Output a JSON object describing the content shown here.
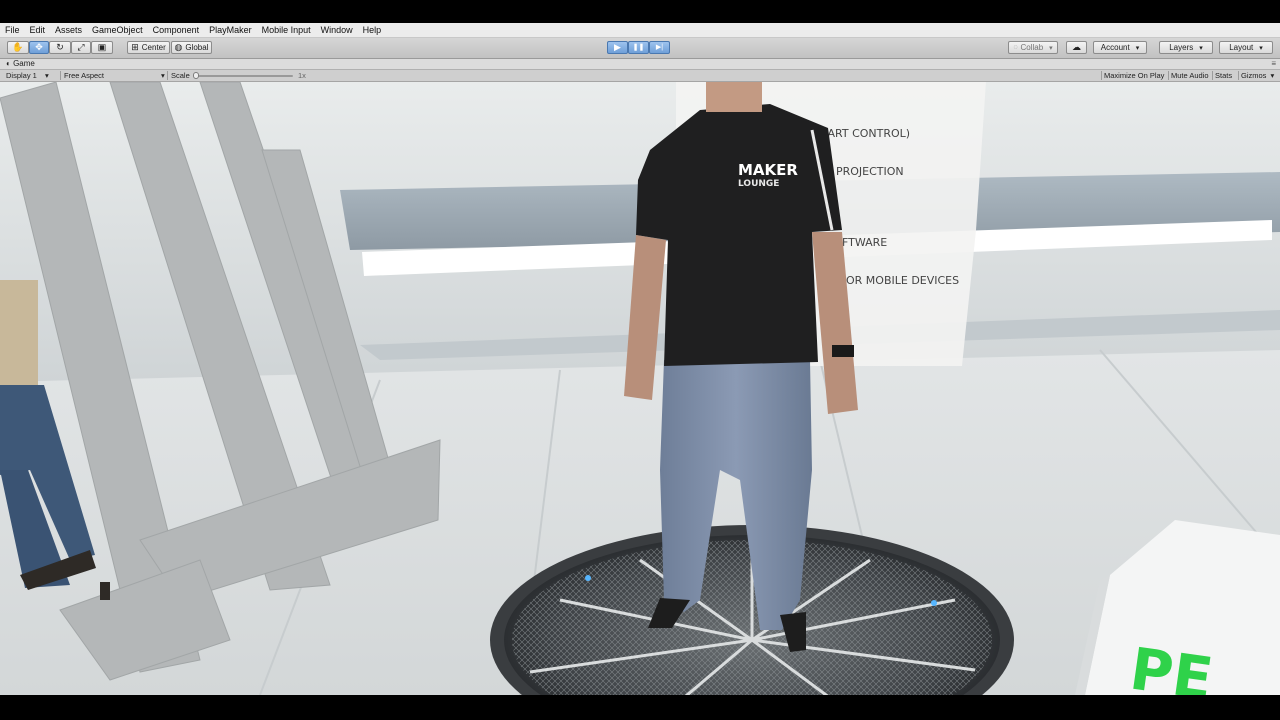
{
  "menubar": {
    "items": [
      "File",
      "Edit",
      "Assets",
      "GameObject",
      "Component",
      "PlayMaker",
      "Mobile Input",
      "Window",
      "Help"
    ]
  },
  "toolbar": {
    "tools": [
      {
        "name": "hand-tool",
        "glyph": "✋"
      },
      {
        "name": "move-tool",
        "glyph": "✥"
      },
      {
        "name": "rotate-tool",
        "glyph": "↻"
      },
      {
        "name": "scale-tool",
        "glyph": "⤢"
      },
      {
        "name": "rect-tool",
        "glyph": "▣"
      }
    ],
    "pivot_mode": "Center",
    "pivot_rotation": "Global",
    "play_glyph": "▶",
    "pause_glyph": "❚❚",
    "step_glyph": "▶|",
    "collab_label": "Collab",
    "cloud_glyph": "☁",
    "account_label": "Account",
    "layers_label": "Layers",
    "layout_label": "Layout"
  },
  "game_tab": {
    "title": "Game",
    "menu_glyph": "≡"
  },
  "game_bar": {
    "display": "Display 1",
    "aspect": "Free Aspect",
    "scale_label": "Scale",
    "scale_value": "1x",
    "maximize_on_play": "Maximize On Play",
    "mute_audio": "Mute Audio",
    "stats": "Stats",
    "gizmos": "Gizmos"
  },
  "scene": {
    "panel_lines": [
      "MART CONTROL)",
      "PROJECTION",
      "FTWARE",
      "OR MOBILE DEVICES"
    ],
    "shirt_logo_line1": "MAKER",
    "shirt_logo_line2": "LOUNGE",
    "cube_text": "PE",
    "colors": {
      "accent_green": "#2fd24a",
      "play_blue": "#6f9fd8"
    }
  }
}
